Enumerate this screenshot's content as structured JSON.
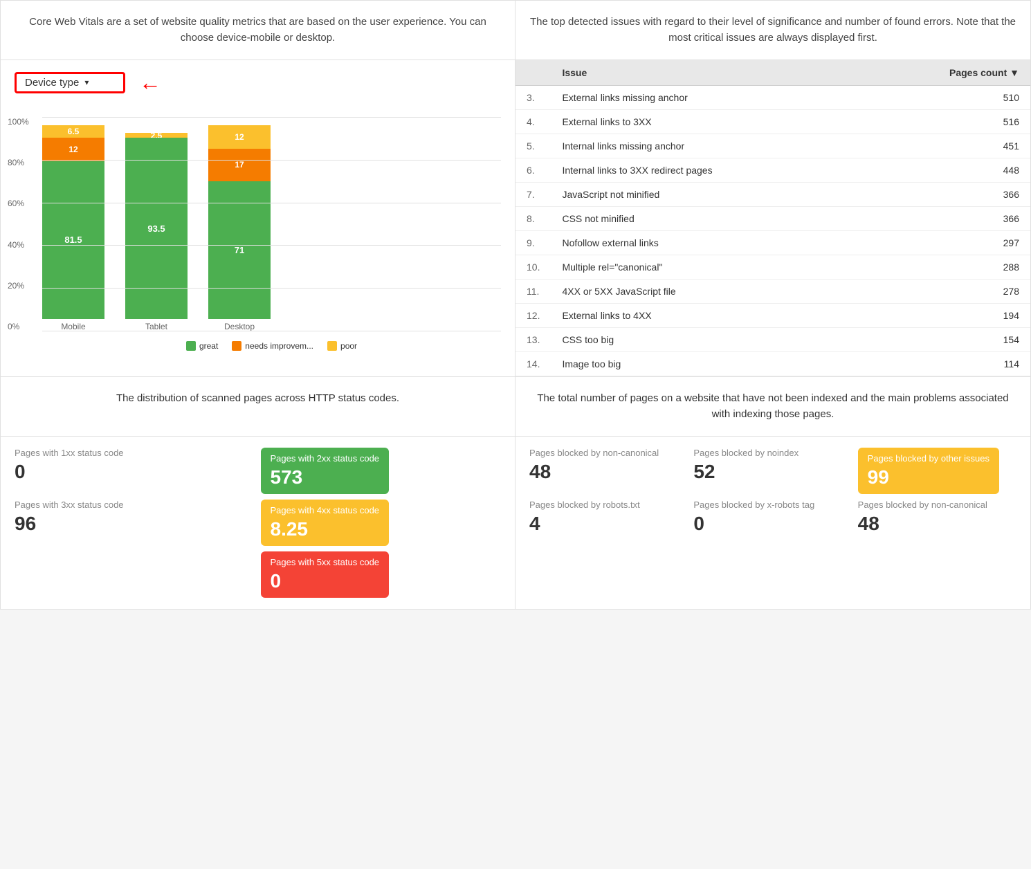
{
  "left_desc": "Core Web Vitals are a set of website quality metrics that are based on the user experience. You can choose device-mobile or desktop.",
  "right_desc": "The top detected issues with regard to their level of significance and number of found errors. Note that the most critical issues are always displayed first.",
  "device_type_label": "Device type",
  "chart": {
    "bars": [
      {
        "label": "Mobile",
        "great": 81.5,
        "needs": 12,
        "poor": 6.5
      },
      {
        "label": "Tablet",
        "great": 93.5,
        "needs": 0,
        "poor": 2.5
      },
      {
        "label": "Desktop",
        "great": 71,
        "needs": 17,
        "poor": 12
      }
    ],
    "y_labels": [
      "100%",
      "80%",
      "60%",
      "40%",
      "20%",
      "0%"
    ],
    "legend": [
      {
        "label": "great",
        "color": "#4caf50"
      },
      {
        "label": "needs improvem...",
        "color": "#f57c00"
      },
      {
        "label": "poor",
        "color": "#fbc02d"
      }
    ]
  },
  "issues_table": {
    "col_issue": "Issue",
    "col_pages": "Pages count",
    "rows": [
      {
        "num": "3.",
        "issue": "External links missing anchor",
        "count": "510"
      },
      {
        "num": "4.",
        "issue": "External links to 3XX",
        "count": "516"
      },
      {
        "num": "5.",
        "issue": "Internal links missing anchor",
        "count": "451"
      },
      {
        "num": "6.",
        "issue": "Internal links to 3XX redirect pages",
        "count": "448"
      },
      {
        "num": "7.",
        "issue": "JavaScript not minified",
        "count": "366"
      },
      {
        "num": "8.",
        "issue": "CSS not minified",
        "count": "366"
      },
      {
        "num": "9.",
        "issue": "Nofollow external links",
        "count": "297"
      },
      {
        "num": "10.",
        "issue": "Multiple rel=\"canonical\"",
        "count": "288"
      },
      {
        "num": "11.",
        "issue": "4XX or 5XX JavaScript file",
        "count": "278"
      },
      {
        "num": "12.",
        "issue": "External links to 4XX",
        "count": "194"
      },
      {
        "num": "13.",
        "issue": "CSS too big",
        "count": "154"
      },
      {
        "num": "14.",
        "issue": "Image too big",
        "count": "114"
      }
    ]
  },
  "http_desc": "The distribution of scanned pages across HTTP status codes.",
  "index_desc": "The total number of pages on a website that have not been indexed and the main problems associated with indexing those pages.",
  "status_codes": {
    "items": [
      {
        "label": "Pages with 1xx status code",
        "value": "0",
        "badge": null
      },
      {
        "label": "Pages with 2xx status code",
        "value": "573",
        "badge": "green"
      },
      {
        "label": "Pages with 3xx status code",
        "value": "96",
        "badge": null
      },
      {
        "label": "Pages with 4xx status code",
        "value": "8.25",
        "badge": "yellow"
      },
      {
        "label": "Pages with 5xx status code",
        "value": "0",
        "badge": "red"
      }
    ]
  },
  "index_issues": {
    "items": [
      {
        "label": "Pages blocked by non-canonical",
        "value": "48",
        "badge": null
      },
      {
        "label": "Pages blocked by noindex",
        "value": "52",
        "badge": null
      },
      {
        "label": "Pages blocked by other issues",
        "value": "99",
        "badge": "orange"
      },
      {
        "label": "Pages blocked by robots.txt",
        "value": "4",
        "badge": null
      },
      {
        "label": "Pages blocked by x-robots tag",
        "value": "0",
        "badge": null
      },
      {
        "label": "Pages blocked by non-canonical",
        "value": "48",
        "badge": null
      }
    ]
  }
}
